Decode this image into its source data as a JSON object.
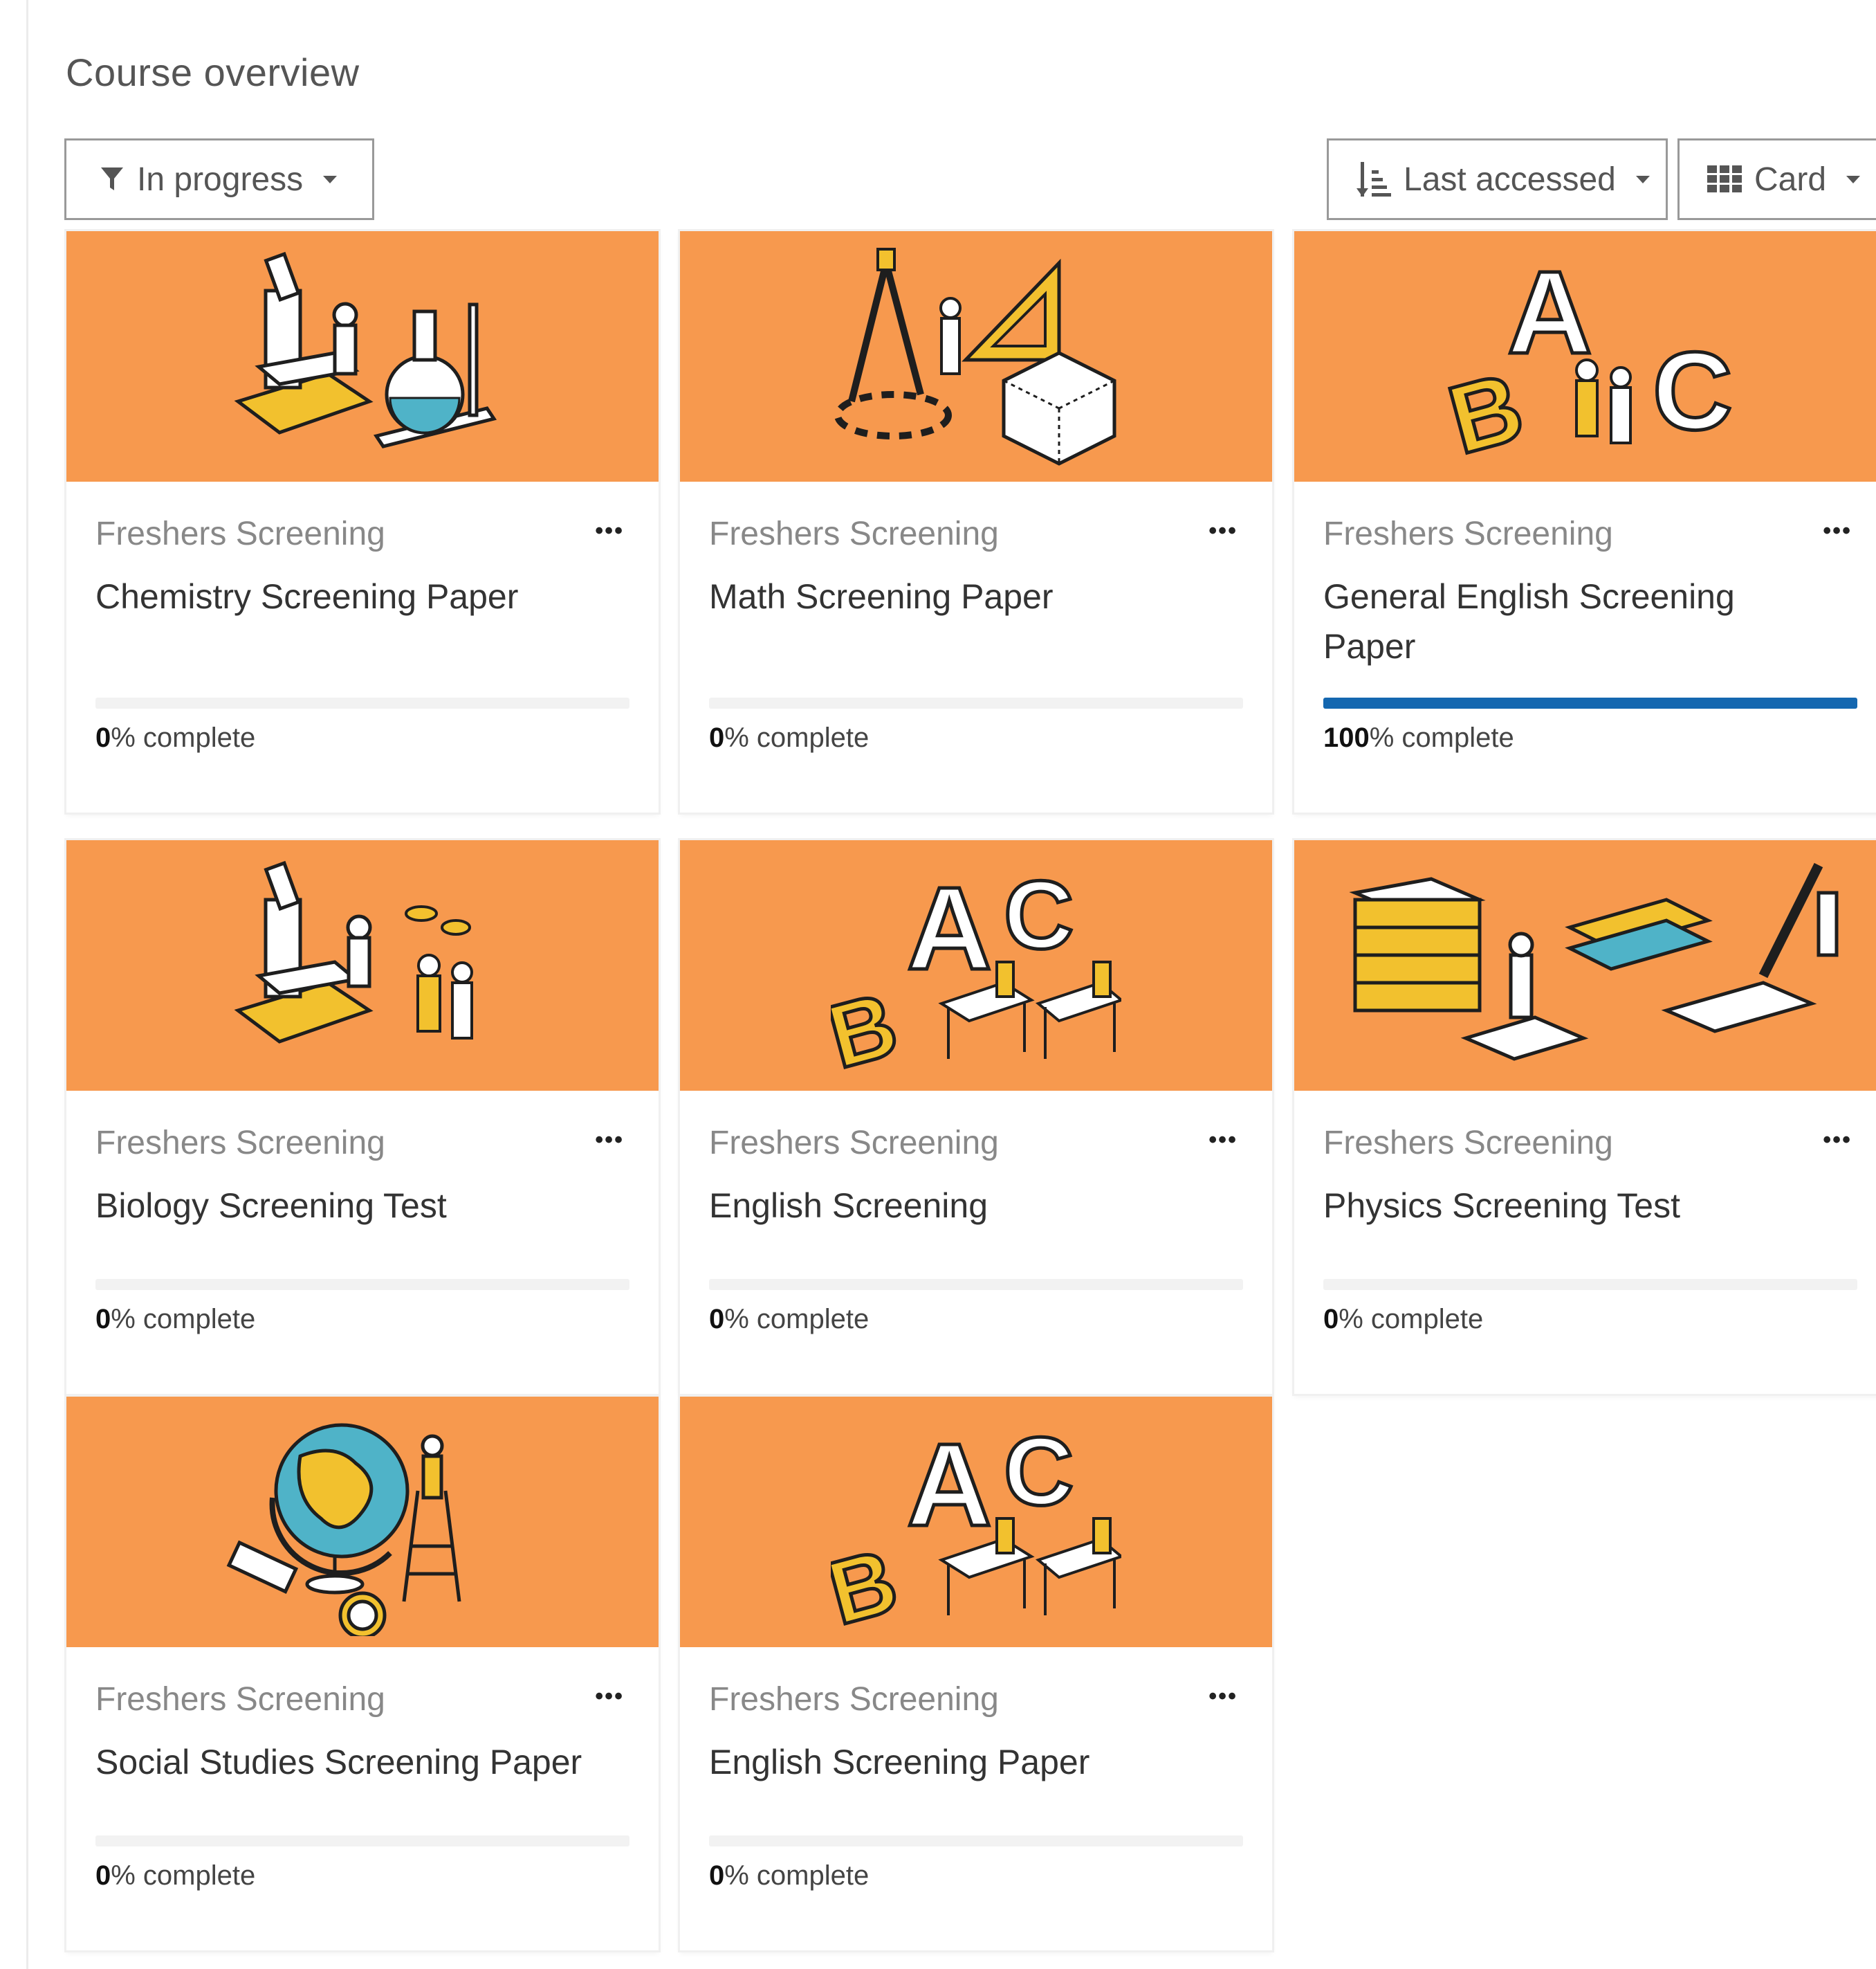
{
  "heading": "Course overview",
  "filter": {
    "label": "In progress"
  },
  "sort": {
    "label": "Last accessed"
  },
  "view": {
    "label": "Card"
  },
  "complete_suffix": "% complete",
  "courses": [
    {
      "category": "Freshers Screening",
      "title": "Chemistry Screening Paper",
      "progress": "0",
      "progress_fraction": 0,
      "image": "chemistry-illustration"
    },
    {
      "category": "Freshers Screening",
      "title": "Math Screening Paper",
      "progress": "0",
      "progress_fraction": 0,
      "image": "math-illustration"
    },
    {
      "category": "Freshers Screening",
      "title": "General English Screening Paper",
      "progress": "100",
      "progress_fraction": 1,
      "image": "abc-illustration"
    },
    {
      "category": "Freshers Screening",
      "title": "Biology Screening Test",
      "progress": "0",
      "progress_fraction": 0,
      "image": "biology-illustration"
    },
    {
      "category": "Freshers Screening",
      "title": "English Screening",
      "progress": "0",
      "progress_fraction": 0,
      "image": "abc-desks-illustration"
    },
    {
      "category": "Freshers Screening",
      "title": "Physics Screening Test",
      "progress": "0",
      "progress_fraction": 0,
      "image": "books-illustration"
    },
    {
      "category": "Freshers Screening",
      "title": "Social Studies Screening Paper",
      "progress": "0",
      "progress_fraction": 0,
      "image": "globe-illustration"
    },
    {
      "category": "Freshers Screening",
      "title": "English Screening Paper",
      "progress": "0",
      "progress_fraction": 0,
      "image": "abc-desks-illustration"
    }
  ],
  "colors": {
    "card_image_bg": "#f7994e",
    "progress_fill": "#1467b0"
  }
}
